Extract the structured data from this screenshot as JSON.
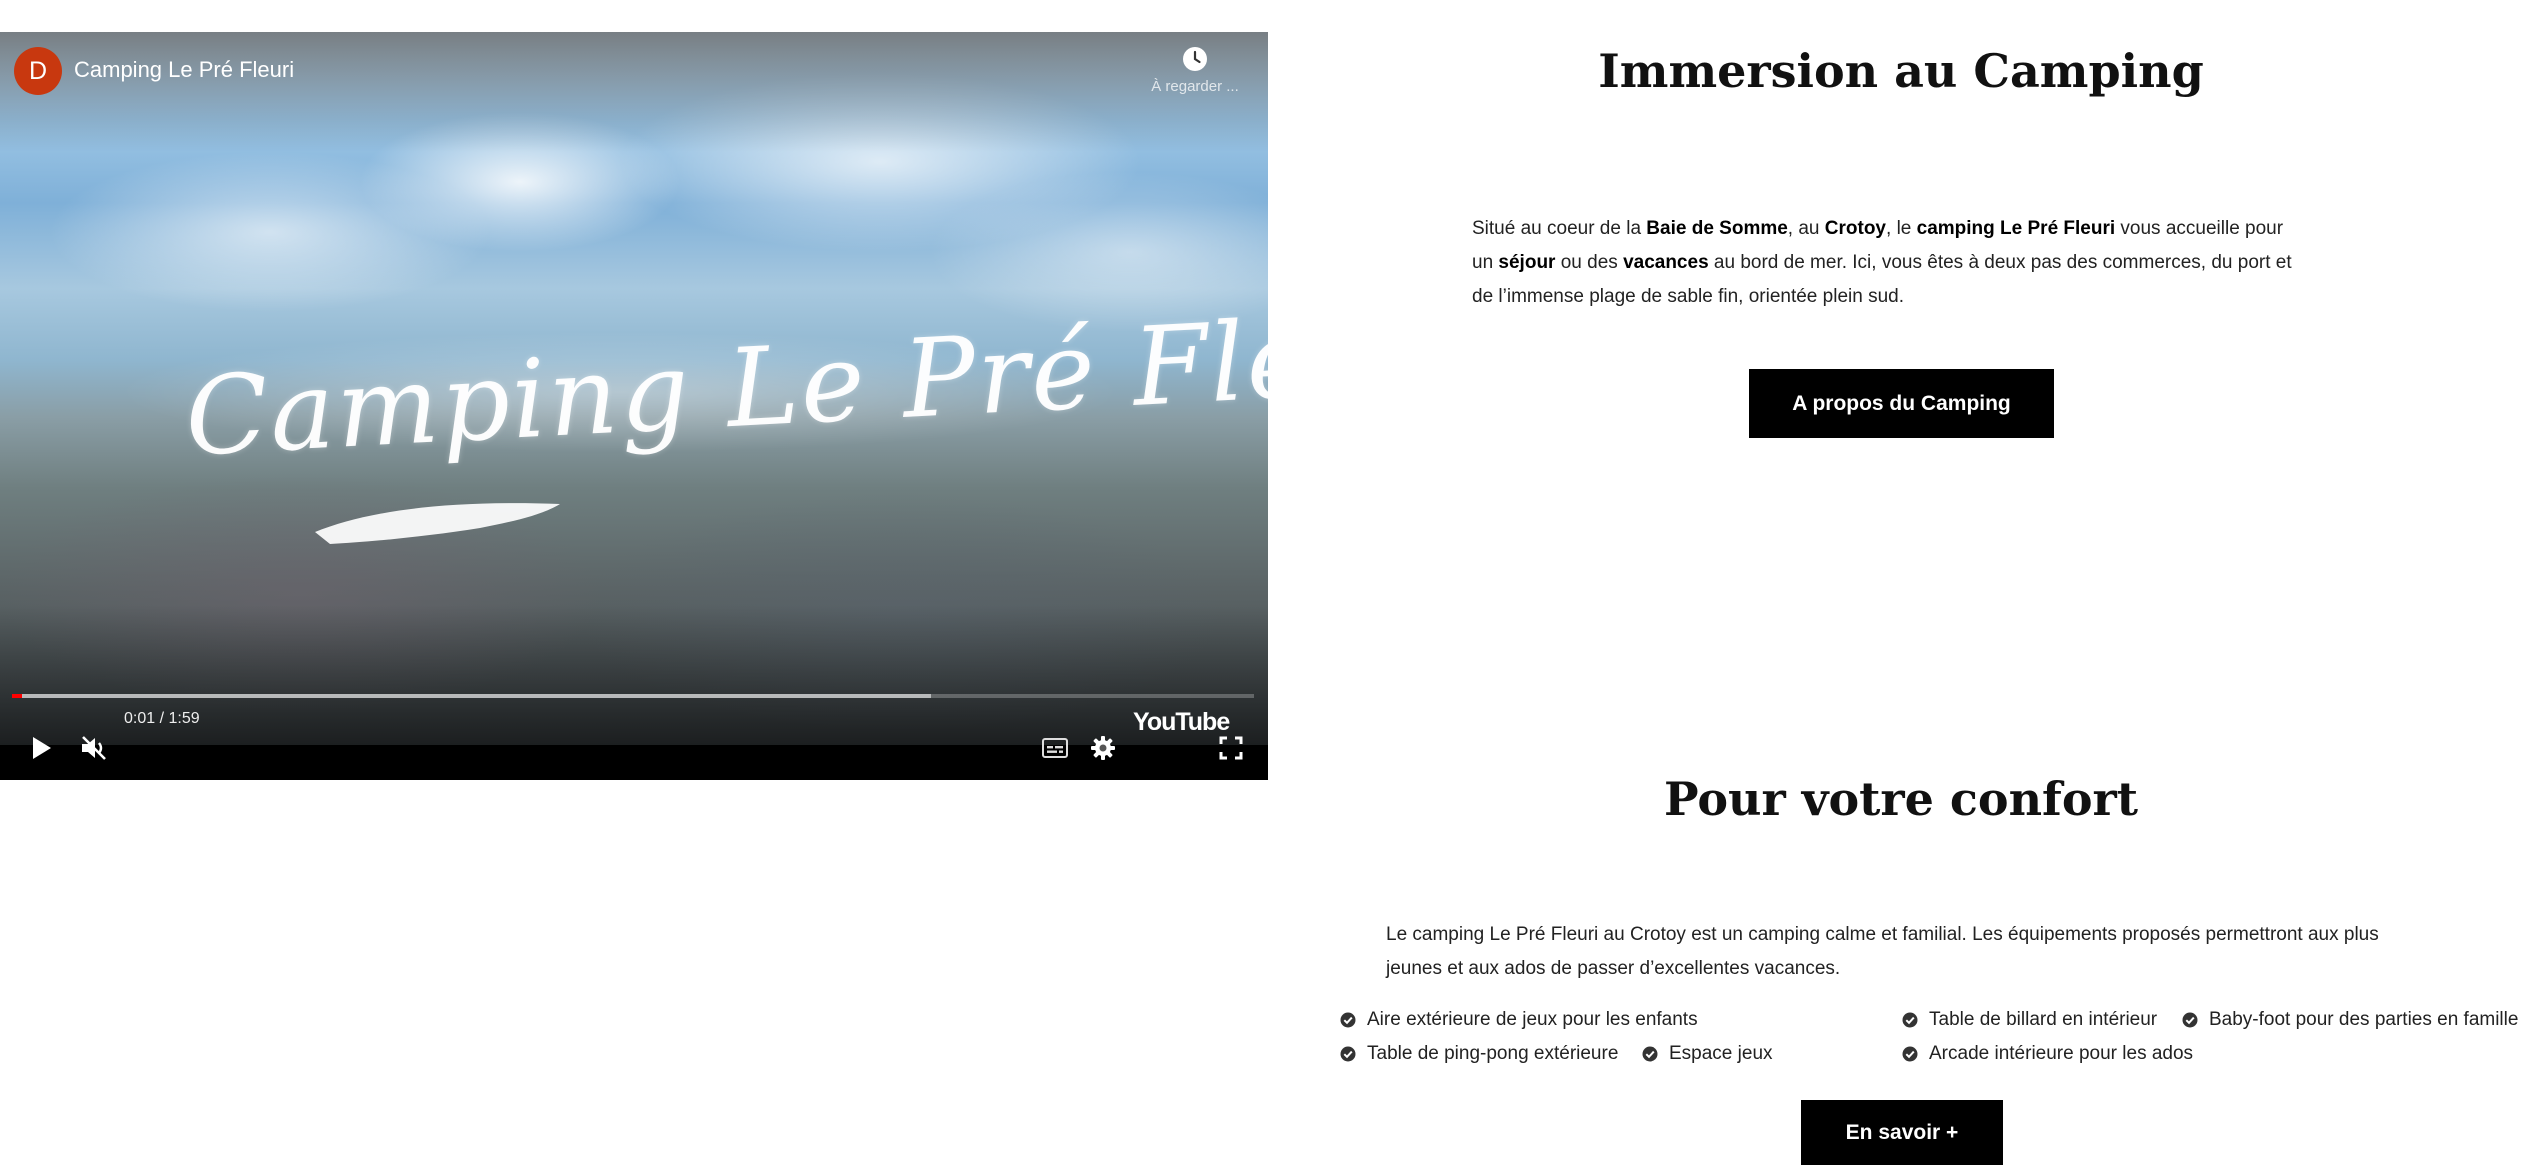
{
  "video": {
    "channel_initial": "D",
    "title": "Camping Le Pré Fleuri",
    "overlay_script": "Camping Le Pré Fleuri",
    "watch_later_label": "À regarder ...",
    "time_current": "0:01",
    "time_total": "1:59",
    "time_display": "0:01 / 1:59",
    "progress_played_fraction": 0.008,
    "progress_buffered_fraction": 0.74,
    "youtube_label": "YouTube",
    "icons": [
      "play-icon",
      "muted-volume-icon",
      "subtitles-icon",
      "settings-gear-icon",
      "fullscreen-icon",
      "clock-icon"
    ]
  },
  "immersion": {
    "title": "Immersion au Camping",
    "text_segments": [
      {
        "text": "Situé au coeur de la ",
        "bold": false
      },
      {
        "text": "Baie de Somme",
        "bold": true
      },
      {
        "text": ", au ",
        "bold": false
      },
      {
        "text": "Crotoy",
        "bold": true
      },
      {
        "text": ", le ",
        "bold": false
      },
      {
        "text": "camping Le Pré Fleuri",
        "bold": true
      },
      {
        "text": " vous accueille pour un ",
        "bold": false
      },
      {
        "text": "séjour",
        "bold": true
      },
      {
        "text": " ou des ",
        "bold": false
      },
      {
        "text": "vacances",
        "bold": true
      },
      {
        "text": " au bord de mer. Ici, vous êtes à deux pas des commerces, du port et de l’immense plage de sable fin, orientée plein sud.",
        "bold": false
      }
    ],
    "button_label": "A propos du Camping"
  },
  "comfort": {
    "title": "Pour votre confort",
    "text": "Le camping Le Pré Fleuri au Crotoy est un camping calme et familial. Les équipements proposés permettront aux plus jeunes et aux ados de passer d’excellentes vacances.",
    "features": [
      "Aire extérieure de jeux pour les enfants",
      "Table de billard en intérieur",
      "Baby-foot pour des parties en famille",
      "Table de ping-pong extérieure",
      "Espace jeux",
      "Arcade intérieure pour les ados"
    ],
    "button_label": "En savoir +"
  },
  "colors": {
    "button_bg": "#000000",
    "progress_played": "#ff0000",
    "avatar_bg": "#c8380f"
  }
}
